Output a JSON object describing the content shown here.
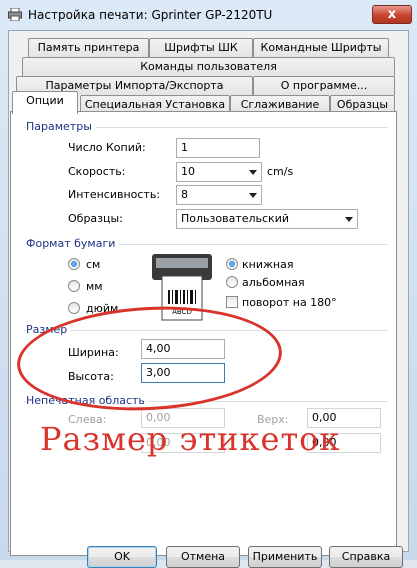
{
  "window": {
    "title": "Настройка печати: Gprinter  GP-2120TU",
    "close_glyph": "x"
  },
  "tabs": {
    "row1": [
      "Память принтера",
      "Шрифты ШК",
      "Командные Шрифты"
    ],
    "row2": [
      "Команды пользователя"
    ],
    "row3": [
      "Параметры Импорта/Экспорта",
      "О программе..."
    ],
    "row4": [
      "Опции",
      "Специальная Установка",
      "Сглаживание",
      "Образцы"
    ]
  },
  "params": {
    "title": "Параметры",
    "copies_label": "Число Копий:",
    "copies_value": "1",
    "speed_label": "Скорость:",
    "speed_value": "10",
    "speed_unit": "cm/s",
    "intensity_label": "Интенсивность:",
    "intensity_value": "8",
    "samples_label": "Образцы:",
    "samples_value": "Пользовательский"
  },
  "paper": {
    "title": "Формат бумаги",
    "unit_cm": "см",
    "unit_mm": "мм",
    "unit_inch": "дюйм",
    "portrait": "книжная",
    "landscape": "альбомная",
    "rotate": "поворот на 180°",
    "label_text": "ABCD"
  },
  "size": {
    "title": "Размер",
    "width_label": "Ширина:",
    "width_value": "4,00",
    "height_label": "Высота:",
    "height_value": "3,00"
  },
  "nonprint": {
    "title": "Непечатная область",
    "left_label": "Слева:",
    "left_value": "0,00",
    "top_label": "Верх:",
    "top_value": "0,00",
    "right_value": "0,00",
    "bottom_value": "0,00"
  },
  "annotation": "Размер этикеток",
  "buttons": {
    "ok": "OK",
    "cancel": "Отмена",
    "apply": "Применить",
    "help": "Справка"
  },
  "colors": {
    "annotation": "#d8342c",
    "group_title": "#1e3287",
    "close": "#c7452f"
  }
}
